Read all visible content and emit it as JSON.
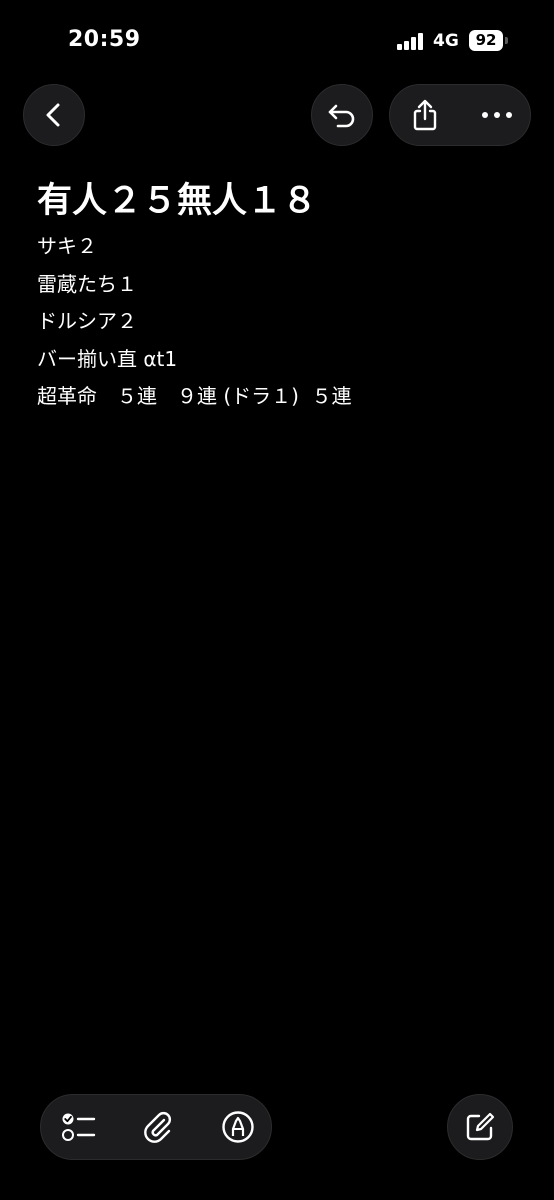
{
  "status_bar": {
    "time": "20:59",
    "network": "4G",
    "battery": "92"
  },
  "toolbar": {
    "back_icon": "chevron-left-icon",
    "undo_icon": "undo-icon",
    "share_icon": "share-icon",
    "more_icon": "ellipsis-icon"
  },
  "note": {
    "title": "有人２５無人１８",
    "lines": [
      "サキ２",
      "雷蔵たち１",
      "ドルシア２",
      "バー揃い直 αt1",
      "超革命　５連　９連 (ドラ１)  ５連"
    ]
  },
  "bottom_toolbar": {
    "checklist_icon": "checklist-icon",
    "attachment_icon": "paperclip-icon",
    "markup_icon": "markup-pen-icon",
    "compose_icon": "compose-icon"
  },
  "colors": {
    "background": "#000000",
    "button_bg": "#1c1c1e",
    "text": "#ffffff"
  }
}
